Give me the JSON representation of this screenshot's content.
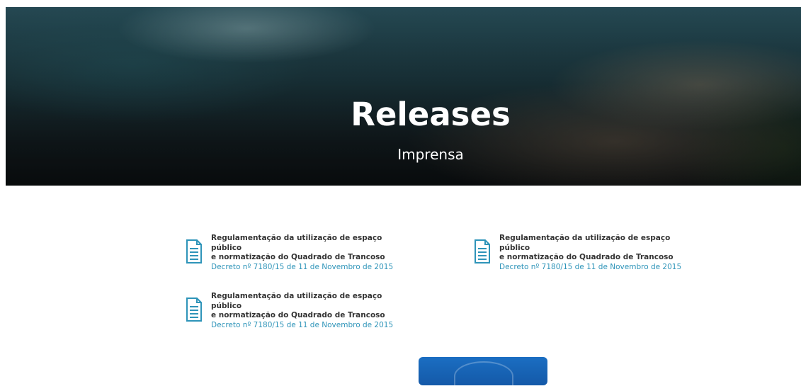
{
  "hero": {
    "title": "Releases",
    "subtitle": "Imprensa"
  },
  "releases": [
    {
      "title_line1": "Regulamentação da utilização de espaço público",
      "title_line2": "e normatização do Quadrado de Trancoso",
      "link": "Decreto nº 7180/15 de 11 de Novembro de 2015",
      "icon": "document-icon"
    },
    {
      "title_line1": "Regulamentação da utilização de espaço público",
      "title_line2": "e normatização do Quadrado de Trancoso",
      "link": "Decreto nº 7180/15 de 11 de Novembro de 2015",
      "icon": "document-icon"
    },
    {
      "title_line1": "Regulamentação da utilização de espaço público",
      "title_line2": "e normatização do Quadrado de Trancoso",
      "link": "Decreto nº 7180/15 de 11 de Novembro de 2015",
      "icon": "document-icon"
    }
  ],
  "colors": {
    "accent": "#2e94b9",
    "text": "#333333",
    "card": "#1b6ec2"
  }
}
